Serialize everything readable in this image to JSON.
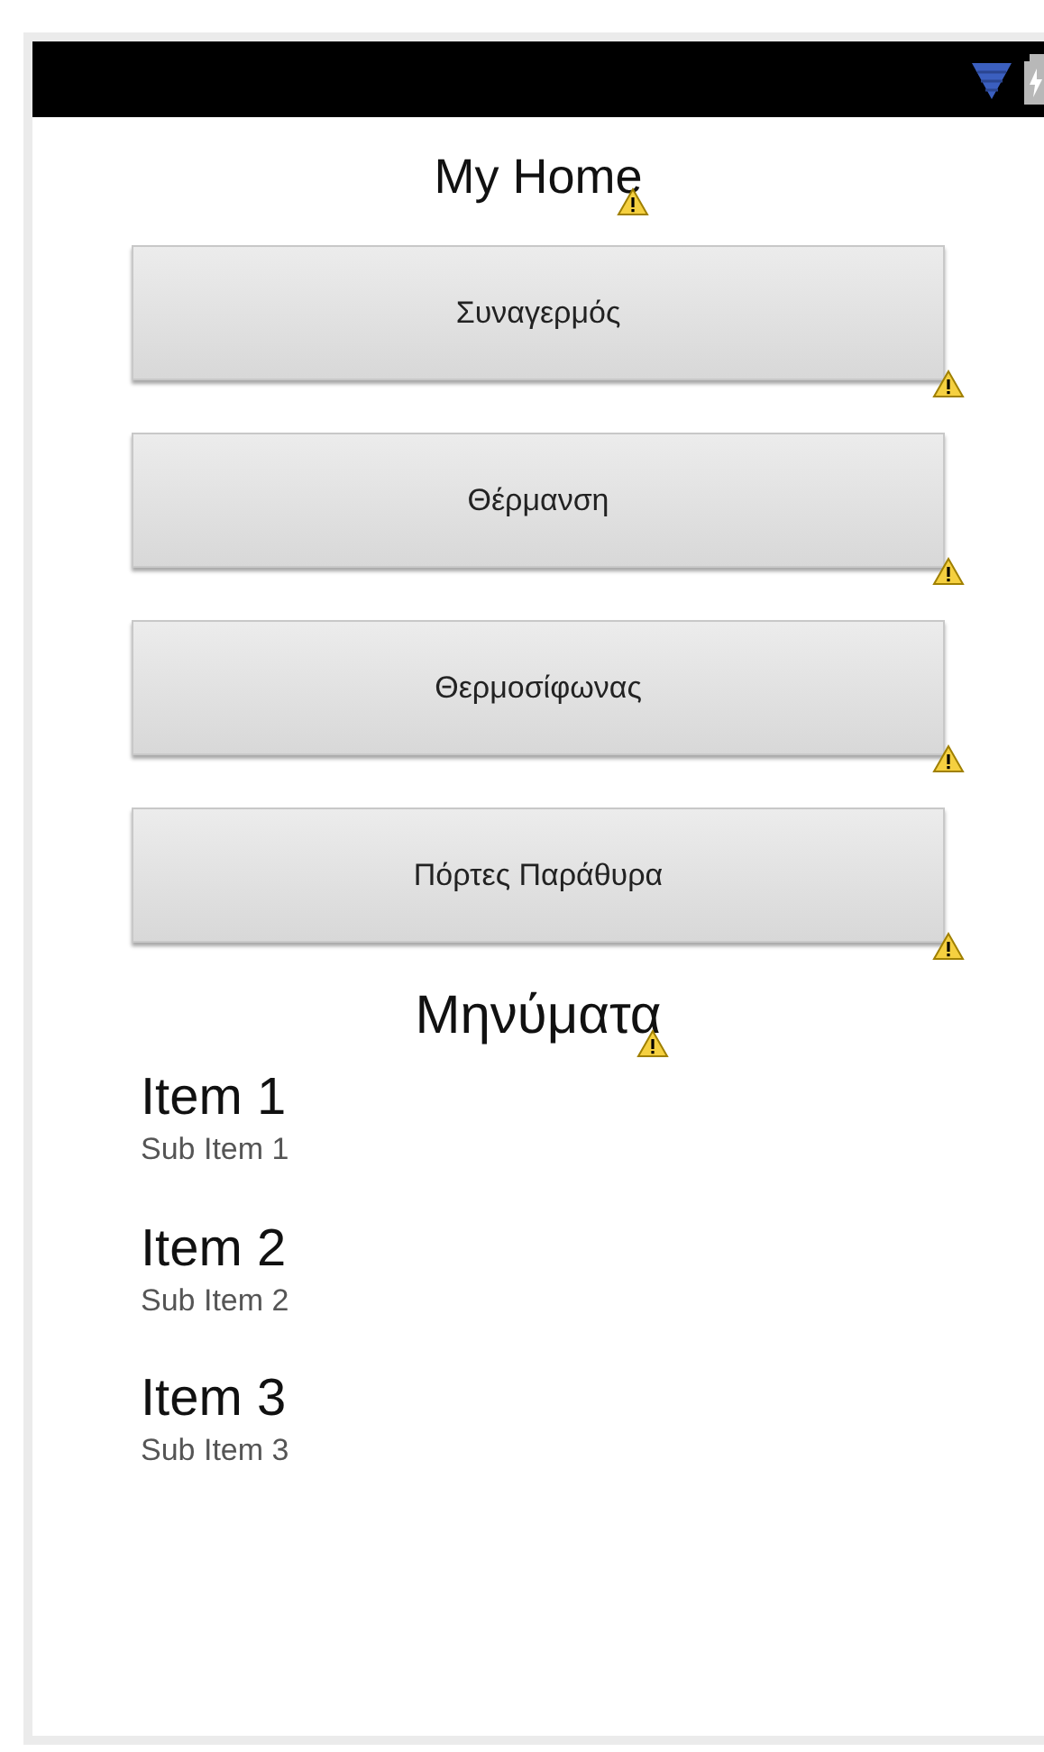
{
  "title": {
    "text": "My Home",
    "warning": true
  },
  "buttons": [
    {
      "label": "Συναγερμός",
      "warning": true
    },
    {
      "label": "Θέρμανση",
      "warning": true
    },
    {
      "label": "Θερμοσίφωνας",
      "warning": true
    },
    {
      "label": "Πόρτες Παράθυρα",
      "warning": true
    }
  ],
  "messages_heading": {
    "text": "Μηνύματα",
    "warning": true
  },
  "list": [
    {
      "title": "Item 1",
      "subtitle": "Sub Item 1"
    },
    {
      "title": "Item 2",
      "subtitle": "Sub Item 2"
    },
    {
      "title": "Item 3",
      "subtitle": "Sub Item 3"
    }
  ]
}
